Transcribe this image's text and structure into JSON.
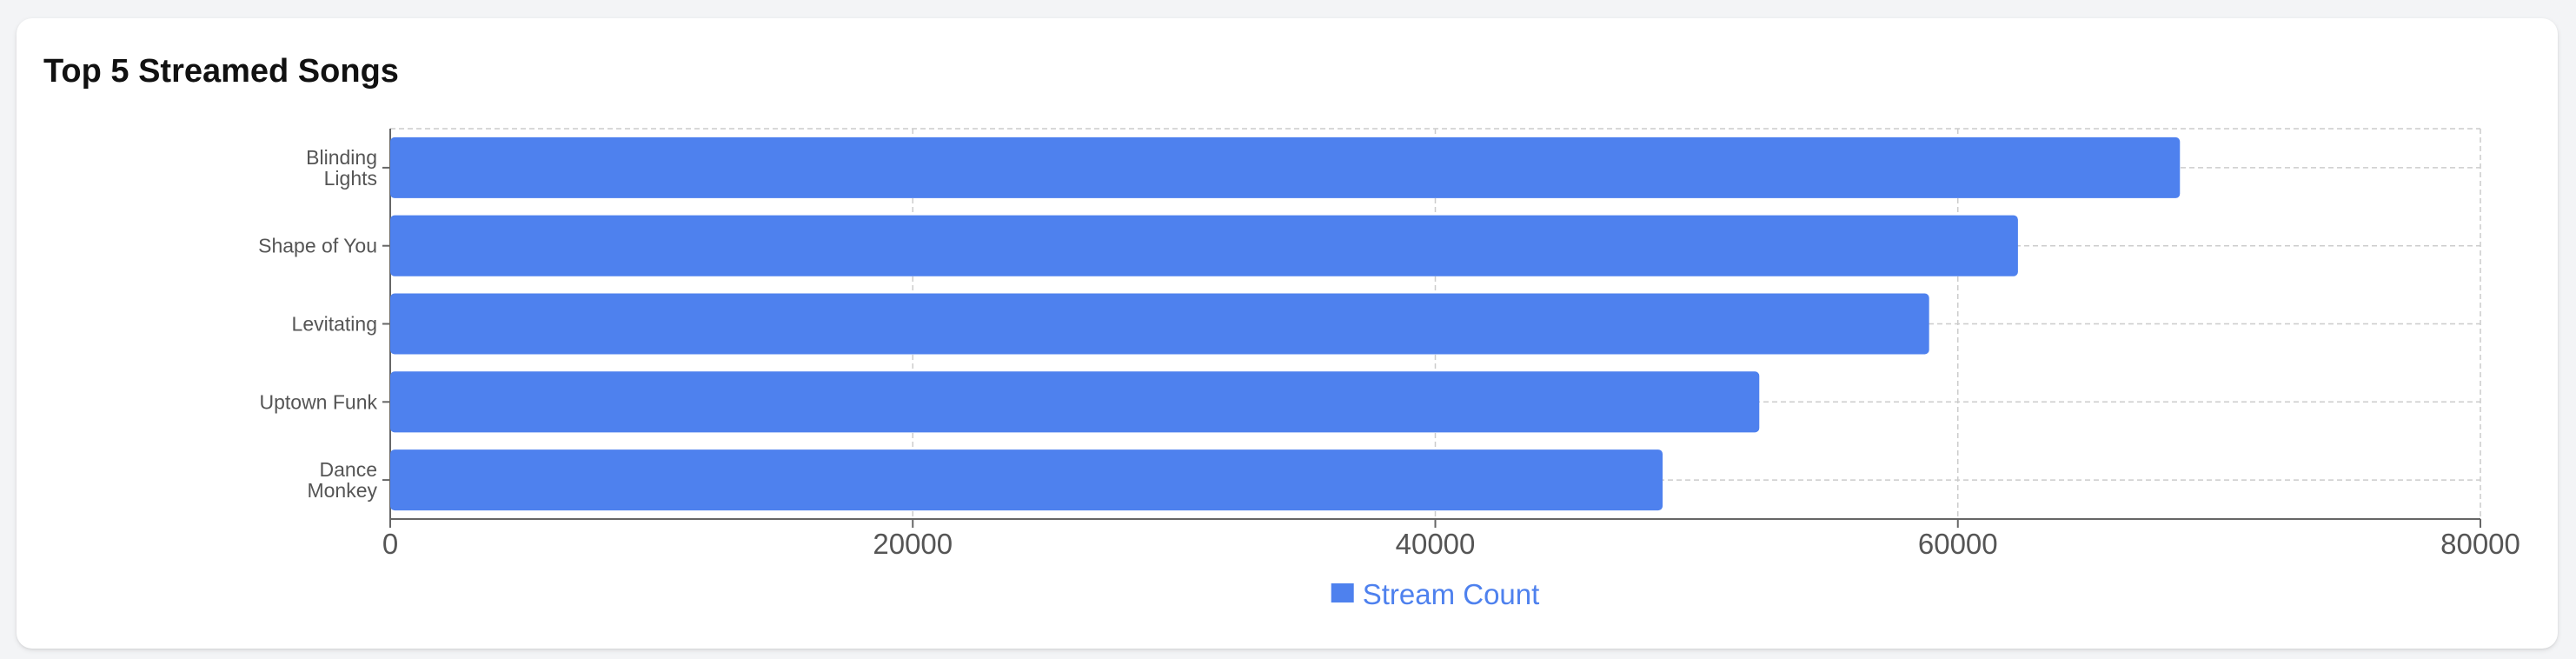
{
  "chart_data": {
    "type": "bar",
    "orientation": "horizontal",
    "title": "Top 5 Streamed Songs",
    "categories": [
      [
        "Blinding",
        "Lights"
      ],
      [
        "Shape of You"
      ],
      [
        "Levitating"
      ],
      [
        "Uptown Funk"
      ],
      [
        "Dance",
        "Monkey"
      ]
    ],
    "series": [
      {
        "name": "Stream Count",
        "values": [
          68500,
          62300,
          58900,
          52400,
          48700
        ],
        "color": "#4e81ee"
      }
    ],
    "xlim": [
      0,
      80000
    ],
    "xticks": [
      0,
      20000,
      40000,
      60000,
      80000
    ],
    "grid": true,
    "legend_position": "bottom-center"
  }
}
